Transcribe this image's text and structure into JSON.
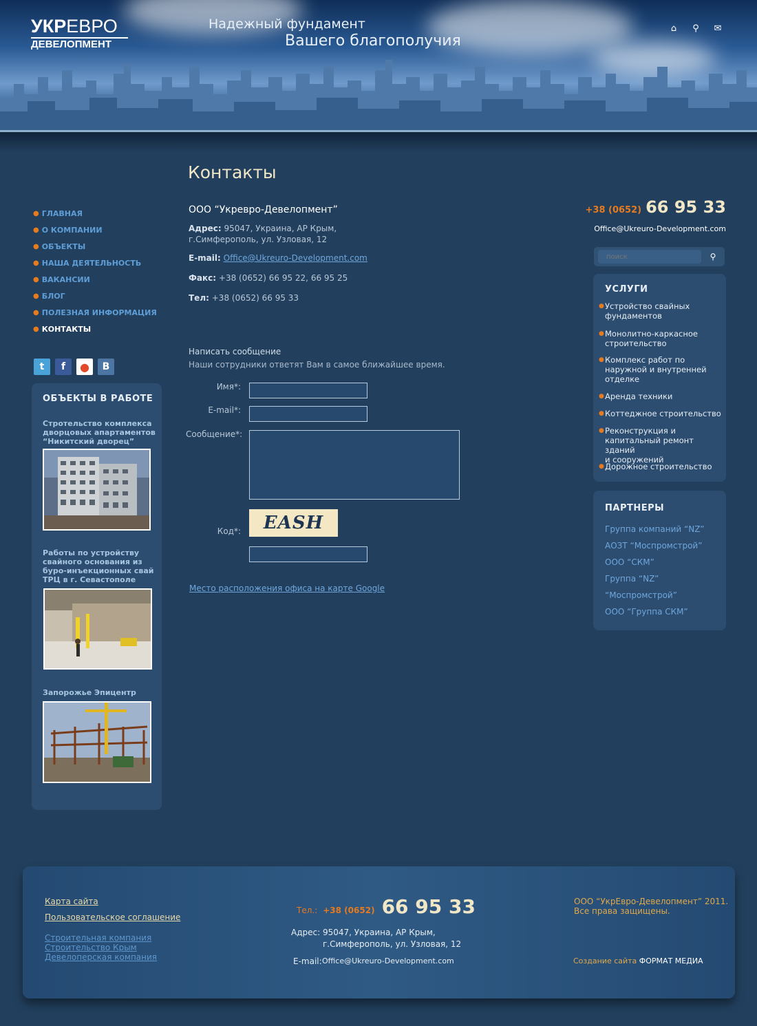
{
  "header": {
    "logo_line1_bold": "УКР",
    "logo_line1_thin": "ЕВРО",
    "logo_line2": "ДЕВЕЛОПМЕНТ",
    "tagline1": "Надежный фундамент",
    "tagline2": "Вашего благополучия",
    "icons": [
      "home-icon",
      "search-icon",
      "mail-icon"
    ]
  },
  "nav": {
    "items": [
      {
        "label": "ГЛАВНАЯ"
      },
      {
        "label": "О КОМПАНИИ"
      },
      {
        "label": "ОБЪЕКТЫ"
      },
      {
        "label": "НАША ДЕЯТЕЛЬНОСТЬ"
      },
      {
        "label": "ВАКАНСИИ"
      },
      {
        "label": "БЛОГ"
      },
      {
        "label": "ПОЛЕЗНАЯ ИНФОРМАЦИЯ"
      },
      {
        "label": "КОНТАКТЫ"
      }
    ],
    "active": "КОНТАКТЫ"
  },
  "social": [
    "twitter-icon",
    "facebook-icon",
    "google-buzz-icon",
    "vkontakte-icon"
  ],
  "objects": {
    "title": "ОБЪЕКТЫ В РАБОТЕ",
    "items": [
      {
        "caption": "Стротельство комплекса дворцовых апартаментов “Никитский дворец”"
      },
      {
        "caption": "Работы по устройству свайного основания из буро-инъекционных свай ТРЦ в г. Севастополе"
      },
      {
        "caption": "Запорожье Эпицентр"
      }
    ]
  },
  "main": {
    "page_title": "Контакты",
    "company": "ООО “Укревро-Девелопмент”",
    "address_label": "Адрес:",
    "address_line1": "95047, Украина, АР Крым,",
    "address_line2": "г.Симферополь, ул. Узловая, 12",
    "email_label": "E-mail:",
    "email": "Office@Ukreuro-Development.com",
    "fax_label": "Факс:",
    "fax": "+38 (0652) 66 95 22, 66 95 25",
    "tel_label": "Тел:",
    "tel": "+38 (0652) 66 95 33",
    "form_title": "Написать сообщение",
    "form_subtitle": "Наши сотрудники ответят Вам в самое ближайшее время.",
    "name_label": "Имя*:",
    "email_field_label": "E-mail*:",
    "message_label": "Сообщение*:",
    "code_label": "Код*:",
    "captcha_text": "EASH",
    "map_link": "Место расположения офиса на карте Google"
  },
  "right": {
    "phone_code": "+38 (0652)",
    "phone_number": "66 95 33",
    "email": "Office@Ukreuro-Development.com",
    "search_placeholder": "поиск",
    "services_title": "УСЛУГИ",
    "services": [
      {
        "line1": "Устройство свайных",
        "line2": "фундаментов",
        "line3": ""
      },
      {
        "line1": "Монолитно-каркасное",
        "line2": "строительство",
        "line3": ""
      },
      {
        "line1": "Комплекс работ по",
        "line2": "наружной и внутренней",
        "line3": "отделке"
      },
      {
        "line1": "Аренда техники",
        "line2": "",
        "line3": ""
      },
      {
        "line1": "Коттеджное строительство",
        "line2": "",
        "line3": ""
      },
      {
        "line1": "Реконструкция и",
        "line2": "капитальный ремонт зданий",
        "line3": "и сооружений"
      },
      {
        "line1": "Дорожное строительство",
        "line2": "",
        "line3": ""
      }
    ],
    "partners_title": "ПАРТНЕРЫ",
    "partners": [
      {
        "label": "Группа компаний “NZ”"
      },
      {
        "label": "АОЗТ “Моспромстрой”"
      },
      {
        "label": "ООО “СКМ”"
      },
      {
        "label": "Группа “NZ”"
      },
      {
        "label": "“Моспромстрой”"
      },
      {
        "label": "ООО “Группа СКМ”"
      }
    ]
  },
  "footer": {
    "sitemap": "Карта сайта",
    "agreement": "Пользовательское соглашение",
    "seo1": "Строительная компания",
    "seo2": "Строительство Крым",
    "seo3": "Девелоперская компания",
    "tel_label": "Тел.:",
    "tel_code": "+38 (0652)",
    "tel_number": "66 95 33",
    "addr_label": "Адрес:",
    "addr_line1": "95047, Украина, АР Крым,",
    "addr_line2": "г.Симферополь, ул. Узловая, 12",
    "email_label": "E-mail:",
    "email": "Office@Ukreuro-Development.com",
    "copyright1": "ООО “УкрЕвро-Девелопмент” 2011.",
    "copyright2": "Все права защищены.",
    "created_label": "Создание сайта",
    "created_by": "ФОРМАТ МЕДИА"
  },
  "colors": {
    "background": "#22405e",
    "accent_orange": "#e67a1e",
    "link_blue": "#6fa6dc",
    "title_cream": "#f1e6c6",
    "box_bg": "#2c4d70"
  }
}
